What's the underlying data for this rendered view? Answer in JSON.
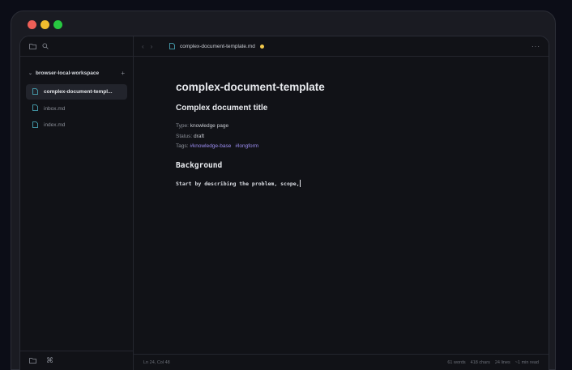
{
  "titlebar": {
    "traffic_lights": [
      {
        "name": "close",
        "color": "#ee5f57"
      },
      {
        "name": "minimize",
        "color": "#f1bc2e"
      },
      {
        "name": "maximize",
        "color": "#27c840"
      }
    ]
  },
  "topbar": {
    "folder_icon": "folder-icon",
    "search_icon": "search-icon",
    "back_label": "‹",
    "forward_label": "›",
    "tab_title": "complex-document-template.md",
    "tab_modified": true,
    "more_label": "···"
  },
  "sidebar": {
    "workspace": "browser-local-workspace",
    "add_label": "+",
    "files": [
      {
        "name": "complex-document-templ...",
        "active": true
      },
      {
        "name": "inbox.md",
        "active": false
      },
      {
        "name": "index.md",
        "active": false
      }
    ],
    "bottom_icons": [
      "folder-icon",
      "command-icon"
    ]
  },
  "document": {
    "file_heading": "complex-document-template",
    "title": "Complex document title",
    "type_label": "Type:",
    "type_value": "knowledge page",
    "status_label": "Status:",
    "status_value": "draft",
    "tags_label": "Tags:",
    "tags": [
      "#knowledge-base",
      "#longform"
    ],
    "section_heading": "Background",
    "paragraph": "Start by describing the problem, scope,"
  },
  "status": {
    "position": "Ln 24, Col 48",
    "words": "61 words",
    "chars": "418 chars",
    "lines": "24 lines",
    "read_time": "~1 min read"
  },
  "colors": {
    "accent": "#4fb6c8",
    "tag": "#9b8cf0",
    "modified_dot": "#f2c94c"
  }
}
